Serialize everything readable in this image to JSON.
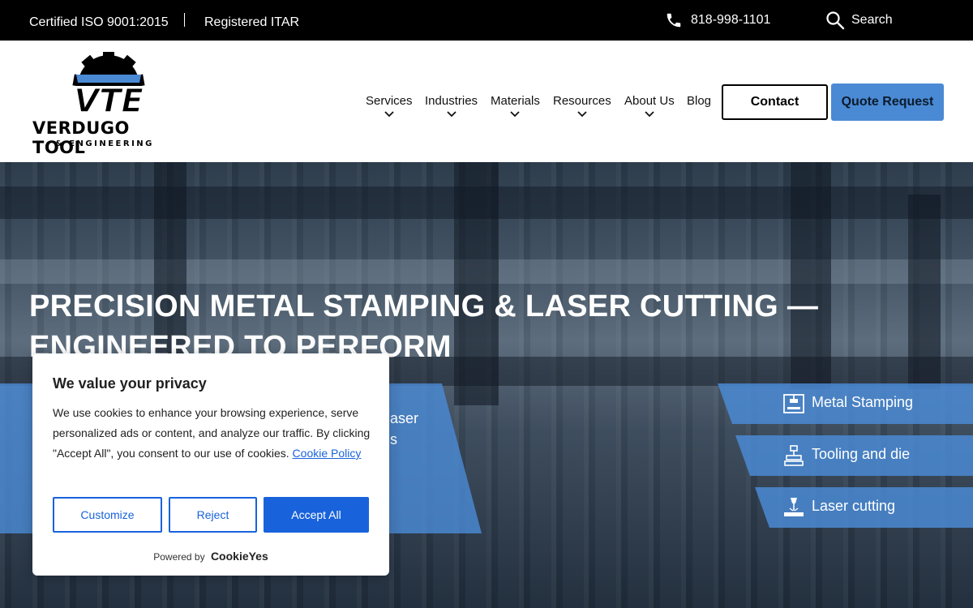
{
  "topbar": {
    "certification": "Certified ISO 9001:2015",
    "registration": "Registered ITAR",
    "phone": "818-998-1101",
    "search_label": "Search"
  },
  "logo": {
    "line1": "VERDUGO TOOL",
    "line2": "& ENGINEERING",
    "colors": {
      "dark": "#000000",
      "accent": "#4a8ad4"
    }
  },
  "nav": {
    "items": [
      {
        "label": "Services",
        "has_dropdown": true
      },
      {
        "label": "Industries",
        "has_dropdown": true
      },
      {
        "label": "Materials",
        "has_dropdown": true
      },
      {
        "label": "Resources",
        "has_dropdown": true
      },
      {
        "label": "About Us",
        "has_dropdown": true
      },
      {
        "label": "Blog",
        "has_dropdown": false
      }
    ],
    "contact_label": "Contact",
    "quote_label": "Quote Request"
  },
  "hero": {
    "title": "PRECISION METAL STAMPING & LASER CUTTING — ENGINEERED TO PERFORM",
    "lead_visible_tail": [
      "aser",
      "s"
    ],
    "services": [
      {
        "label": "Metal Stamping",
        "icon": "press-icon"
      },
      {
        "label": "Tooling and die",
        "icon": "die-icon"
      },
      {
        "label": "Laser cutting",
        "icon": "laser-icon"
      }
    ]
  },
  "cookie_banner": {
    "title": "We value your privacy",
    "message": "We use cookies to enhance your browsing experience, serve personalized ads or content, and analyze our traffic. By clicking \"Accept All\", you consent to our use of cookies.",
    "policy_link": "Cookie Policy",
    "customize_label": "Customize",
    "reject_label": "Reject",
    "accept_label": "Accept All",
    "powered_by": "Powered by",
    "brand": "CookieYes"
  },
  "colors": {
    "accent": "#4a8ad4",
    "cookie_primary": "#1863dc",
    "topbar_bg": "#000000"
  }
}
